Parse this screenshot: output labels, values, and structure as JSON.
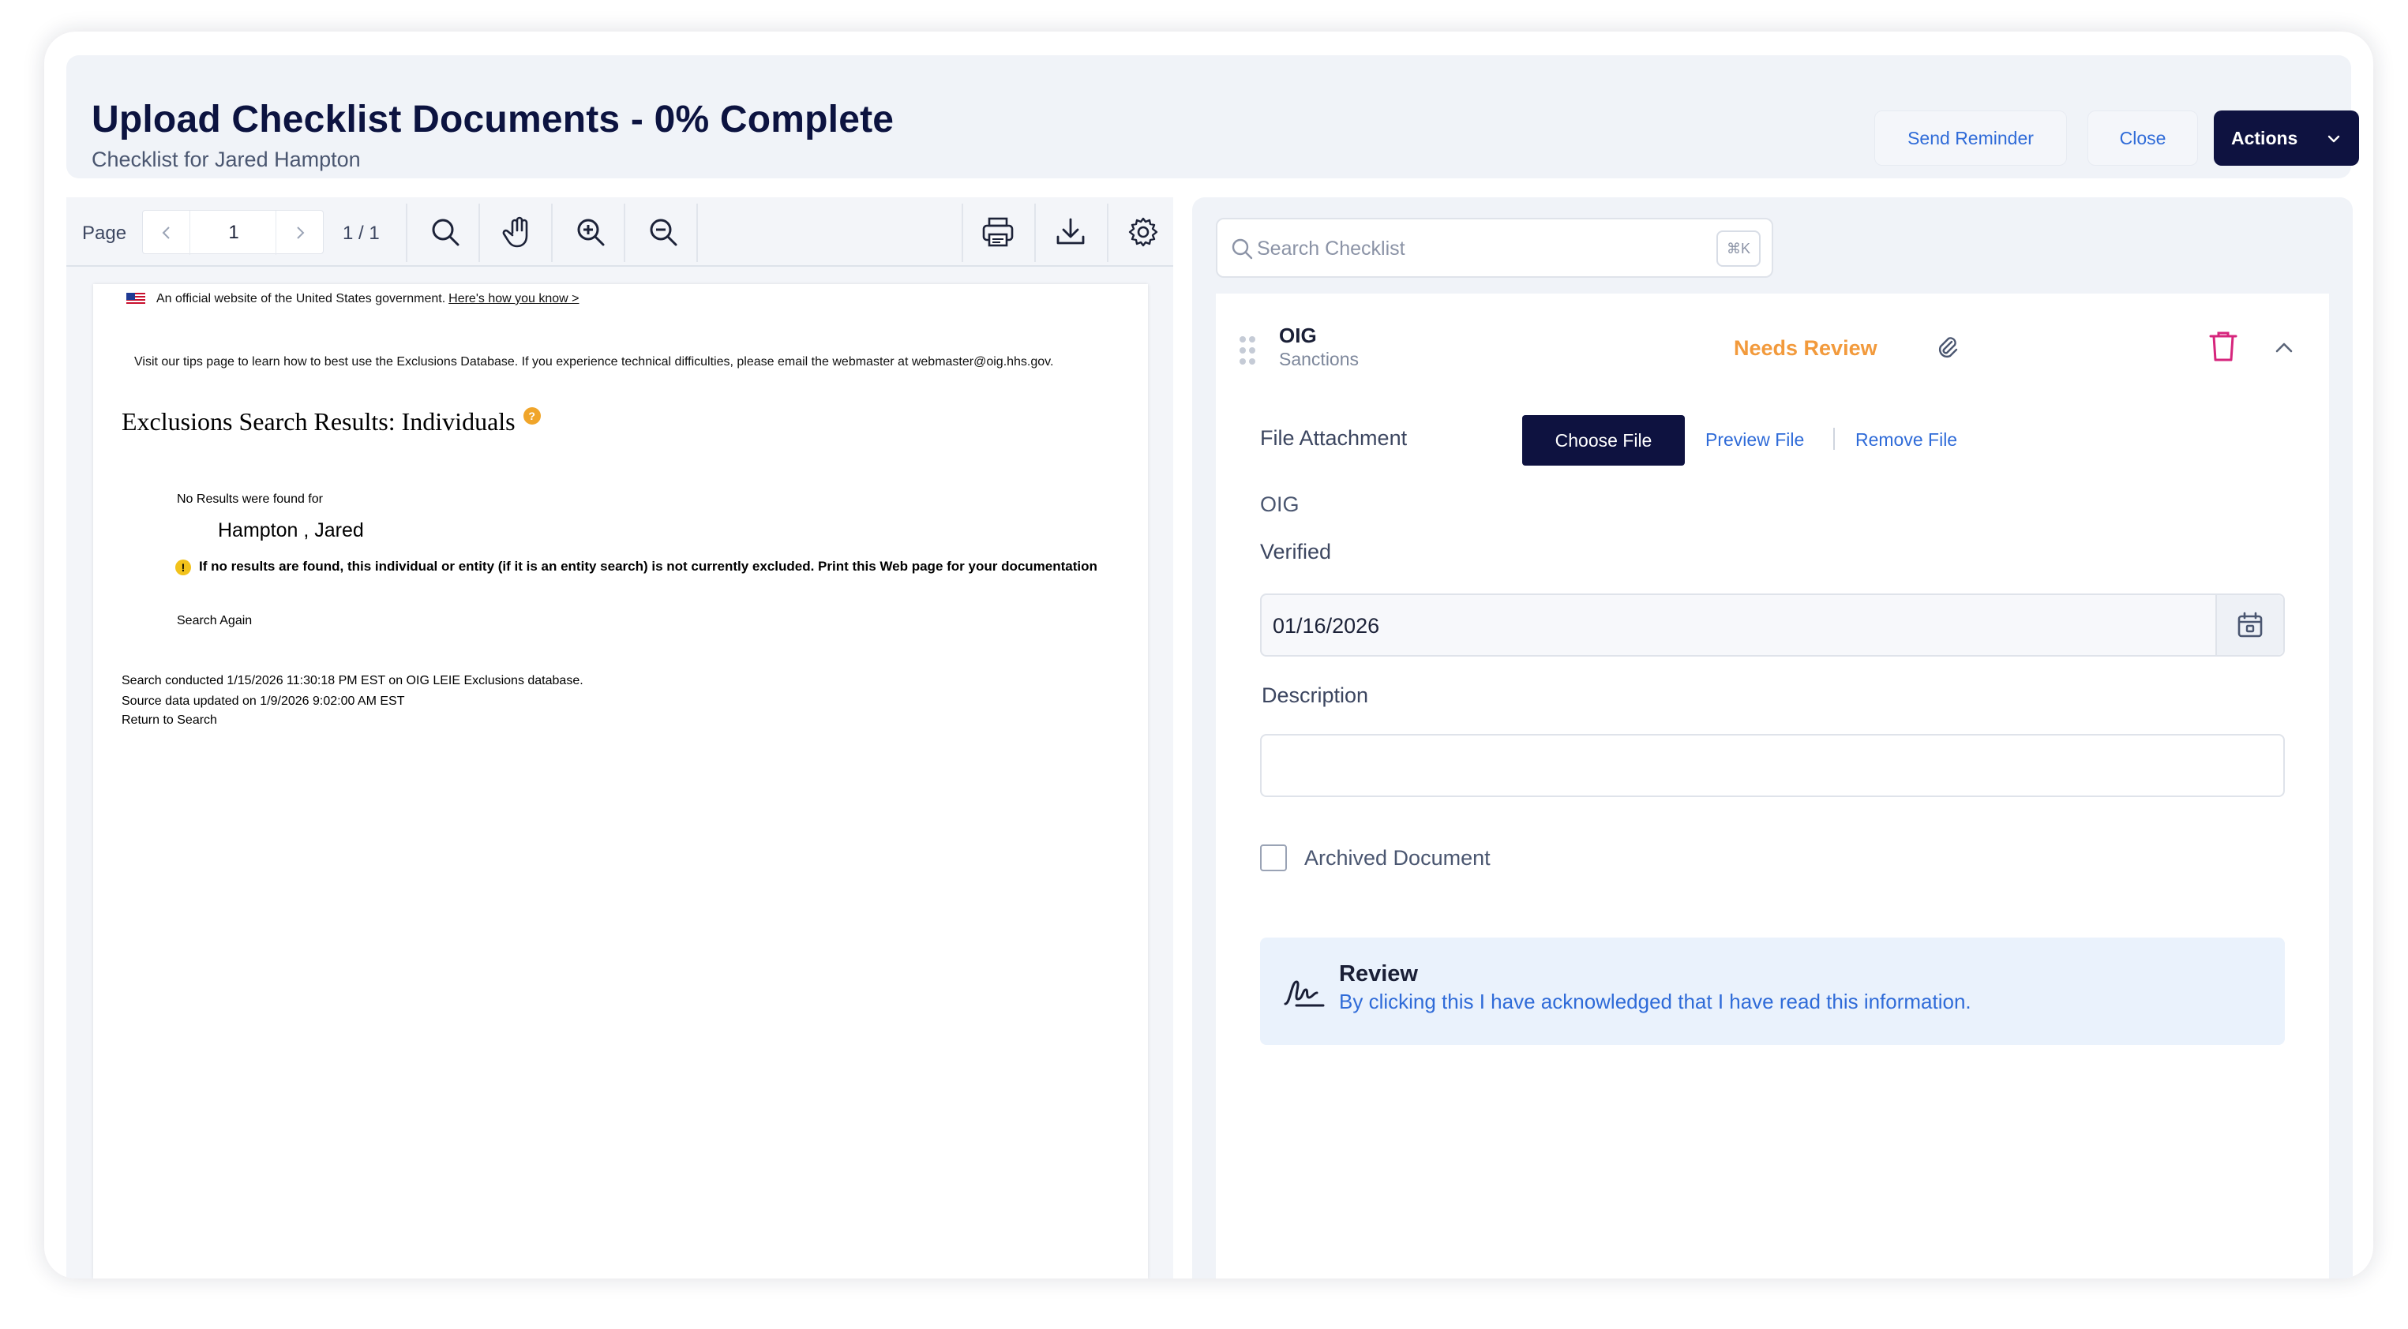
{
  "header": {
    "title": "Upload Checklist Documents - 0% Complete",
    "subtitle": "Checklist for Jared Hampton",
    "send_reminder": "Send Reminder",
    "close": "Close",
    "actions": "Actions"
  },
  "viewer": {
    "page_label": "Page",
    "current_page": "1",
    "page_count": "1 / 1",
    "icons": [
      "search-icon",
      "pan-hand-icon",
      "zoom-in-icon",
      "zoom-out-icon",
      "print-icon",
      "download-icon",
      "settings-icon"
    ],
    "document": {
      "gov_banner": "An official website of the United States government.",
      "gov_link": "Here's how you know >",
      "tips": "Visit our tips page to learn how to best use the Exclusions Database. If you experience technical difficulties, please email the webmaster at webmaster@oig.hhs.gov.",
      "heading": "Exclusions Search Results: Individuals",
      "help_badge": "?",
      "no_results": "No Results were found for",
      "name": "Hampton , Jared",
      "warning_symbol": "!",
      "warning": "If no results are found, this individual or entity (if it is an entity search) is not currently excluded. Print this Web page for your documentation",
      "search_again": "Search Again",
      "conducted": "Search conducted 1/15/2026 11:30:18 PM EST on OIG LEIE Exclusions database.",
      "source_updated": "Source data updated on 1/9/2026 9:02:00 AM EST",
      "return": "Return to Search"
    }
  },
  "checklist": {
    "search_placeholder": "Search Checklist",
    "search_shortcut": "⌘K",
    "item": {
      "title": "OIG",
      "category": "Sanctions",
      "status": "Needs Review",
      "status_color": "#f29a3c"
    },
    "file_attachment_label": "File Attachment",
    "choose_file": "Choose File",
    "preview_file": "Preview File",
    "remove_file": "Remove File",
    "section_label": "OIG",
    "verified_label": "Verified",
    "verified_value": "01/16/2026",
    "description_label": "Description",
    "description_value": "",
    "archived_label": "Archived Document",
    "archived_checked": false,
    "review_title": "Review",
    "review_text": "By clicking this I have acknowledged that I have read this information."
  },
  "colors": {
    "primary_dark": "#0e1240",
    "link_blue": "#2f6bd8",
    "delete_pink": "#d6257c",
    "panel_bg": "#f0f3f8"
  }
}
